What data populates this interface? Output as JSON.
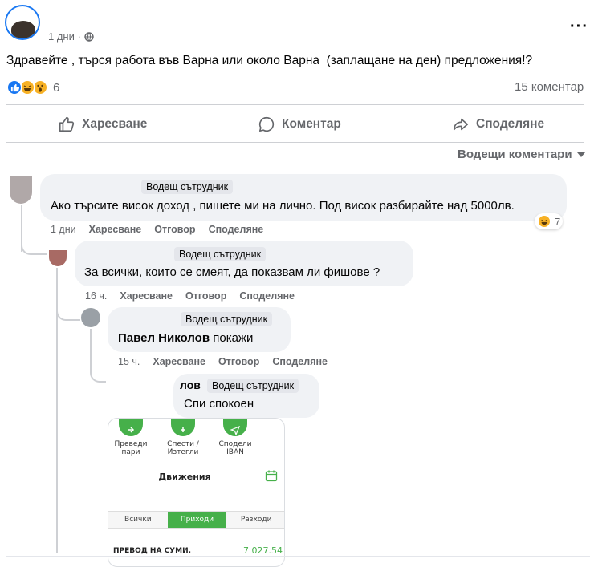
{
  "post": {
    "time": "1 дни ·",
    "text": "Здравейте , търся работа във Варна или около Варна  (заплащане на ден) предложения!?",
    "reaction_count": "6",
    "comments_count": "15 коментар",
    "more": "···"
  },
  "actions": {
    "like": "Харесване",
    "comment": "Коментар",
    "share": "Споделяне"
  },
  "sort_label": "Водещи коментари",
  "comments": [
    {
      "badge": "Водещ сътрудник",
      "text": "Ако търсите висок доход , пишете ми на лично. Под висок разбирайте над 5000лв.",
      "time": "1 дни",
      "like": "Харесване",
      "reply": "Отговор",
      "share": "Споделяне",
      "reaction_count": "7"
    },
    {
      "badge": "Водещ сътрудник",
      "text": "За всички, които се смеят, да показвам ли фишове ?",
      "time": "16 ч.",
      "like": "Харесване",
      "reply": "Отговор",
      "share": "Споделяне"
    },
    {
      "badge": "Водещ сътрудник",
      "mention": "Павел Николов",
      "text": " покажи",
      "time": "15 ч.",
      "like": "Харесване",
      "reply": "Отговор",
      "share": "Споделяне"
    },
    {
      "badge": "Водещ сътрудник",
      "name_fragment": "лов",
      "text": "Спи спокоен"
    }
  ],
  "attachment": {
    "buttons": [
      {
        "label": "Преведи\nпари"
      },
      {
        "label": "Спести /\nИзтегли"
      },
      {
        "label": "Сподели\nIBAN"
      }
    ],
    "title": "Движения",
    "tabs": [
      "Всички",
      "Приходи",
      "Разходи"
    ],
    "transaction_label": "ПРЕВОД НА СУМИ.",
    "transaction_amount": "7 027.54"
  }
}
